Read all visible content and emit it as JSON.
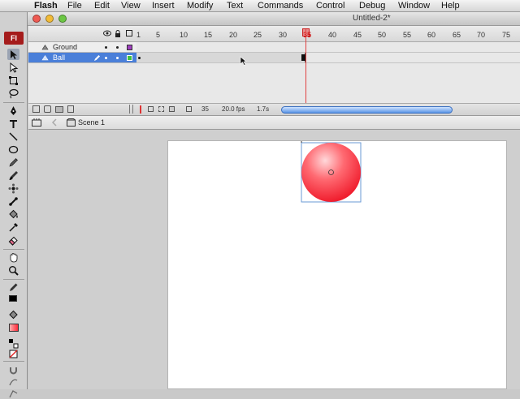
{
  "menu": {
    "apple_glyph": "",
    "items": [
      "Flash",
      "File",
      "Edit",
      "View",
      "Insert",
      "Modify",
      "Text",
      "Commands",
      "Control",
      "Debug",
      "Window",
      "Help"
    ]
  },
  "window": {
    "title": "Untitled-2*"
  },
  "app_logo": "Fl",
  "timeline": {
    "frame_ticks": [
      "1",
      "5",
      "10",
      "15",
      "20",
      "25",
      "30",
      "35",
      "40",
      "45",
      "50",
      "55",
      "60",
      "65",
      "70",
      "75"
    ],
    "current_frame_index": 35,
    "layers": [
      {
        "name": "Ground",
        "color": "#a040c0",
        "selected": false
      },
      {
        "name": "Ball",
        "color": "#40c040",
        "selected": true
      }
    ],
    "footer": {
      "frame": "35",
      "fps": "20.0 fps",
      "time": "1.7s"
    }
  },
  "editbar": {
    "scene": "Scene 1"
  },
  "colors": {
    "accent": "#4a7fd9",
    "ball_fill": "#ff4a55",
    "stage": "#ffffff"
  },
  "icons": {
    "tools": [
      "selection-arrow-icon",
      "subselection-icon",
      "free-transform-icon",
      "lasso-icon",
      "pen-icon",
      "text-tool-icon",
      "line-tool-icon",
      "oval-tool-icon",
      "pencil-icon",
      "brush-icon",
      "deco-icon",
      "bone-icon",
      "paint-bucket-icon",
      "eyedropper-icon",
      "eraser-icon",
      "hand-icon",
      "zoom-icon"
    ]
  }
}
